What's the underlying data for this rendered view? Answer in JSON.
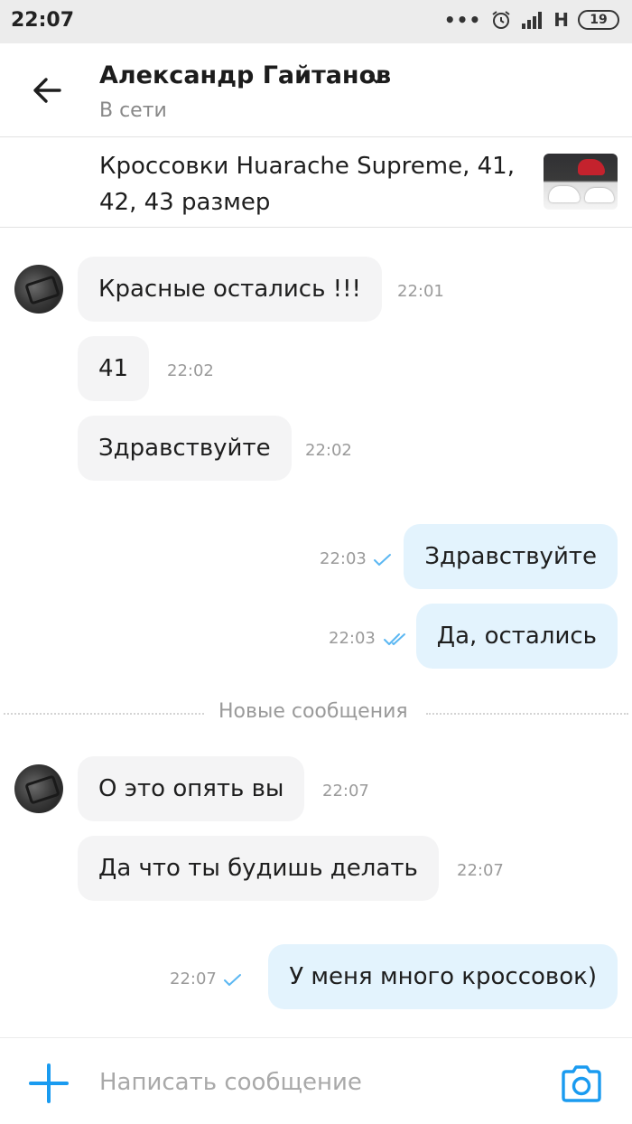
{
  "status_bar": {
    "time": "22:07",
    "dots": "•••",
    "network": "H",
    "battery": "19"
  },
  "header": {
    "contact_name": "Александр Гайтанов",
    "contact_status": "В сети"
  },
  "ad": {
    "title": "Кроссовки Huarache Supreme, 41, 42, 43 размер"
  },
  "messages": [
    {
      "direction": "in",
      "text": "Красные остались !!!",
      "time": "22:01"
    },
    {
      "direction": "in",
      "text": "41",
      "time": "22:02"
    },
    {
      "direction": "in",
      "text": "Здравствуйте",
      "time": "22:02"
    },
    {
      "direction": "out",
      "text": "Здравствуйте",
      "time": "22:03",
      "status": "sent"
    },
    {
      "direction": "out",
      "text": "Да, остались",
      "time": "22:03",
      "status": "read"
    },
    {
      "direction": "in",
      "text": "О это опять вы",
      "time": "22:07"
    },
    {
      "direction": "in",
      "text": "Да что ты будишь делать",
      "time": "22:07"
    },
    {
      "direction": "out",
      "text": "У меня много кроссовок)",
      "time": "22:07",
      "status": "sent"
    }
  ],
  "divider": {
    "label": "Новые сообщения"
  },
  "composer": {
    "placeholder": "Написать сообщение"
  },
  "colors": {
    "accent": "#1a9bf0",
    "incoming_bubble": "#f4f4f5",
    "outgoing_bubble": "#e3f3fd",
    "status_bar_bg": "#ececec"
  },
  "icons": {
    "back": "arrow-left-icon",
    "dropdown": "chevron-down-icon",
    "add": "plus-icon",
    "camera": "camera-icon",
    "sent": "check-icon",
    "read": "double-check-icon"
  }
}
